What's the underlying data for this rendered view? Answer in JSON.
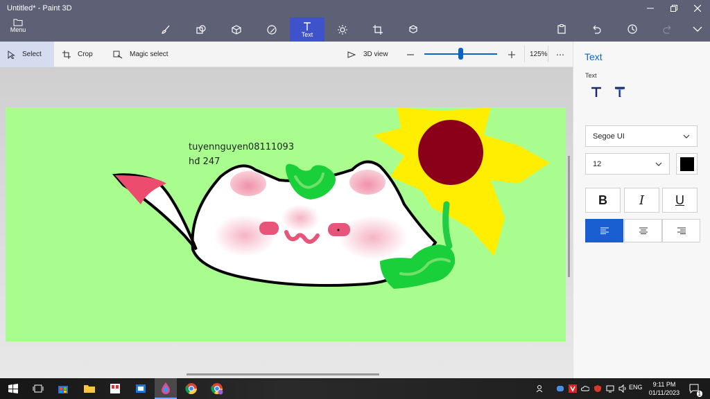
{
  "window": {
    "title": "Untitled* - Paint 3D",
    "menu_label": "Menu"
  },
  "toolbar": {
    "tools": [
      {
        "name": "brushes",
        "icon": "brush-icon"
      },
      {
        "name": "2d-shapes",
        "icon": "shapes-icon"
      },
      {
        "name": "3d-shapes",
        "icon": "cube-icon"
      },
      {
        "name": "stickers",
        "icon": "sticker-icon"
      },
      {
        "name": "text",
        "icon": "text-icon",
        "label": "Text"
      },
      {
        "name": "effects",
        "icon": "effects-icon"
      },
      {
        "name": "canvas",
        "icon": "canvas-icon"
      },
      {
        "name": "3d-library",
        "icon": "library-icon"
      }
    ],
    "active_tool_label": "Text"
  },
  "subbar": {
    "select_label": "Select",
    "crop_label": "Crop",
    "magic_select_label": "Magic select",
    "view3d_label": "3D view",
    "zoom_level": "125%",
    "zoom_fraction": 0.5
  },
  "canvas": {
    "background_color": "#a8fd8e",
    "text_line1": "tuyennguyen08111093",
    "text_line2": "hđ 247"
  },
  "panel": {
    "title": "Text",
    "section_label": "Text",
    "font_family": "Segoe UI",
    "font_size": "12",
    "text_color": "#000000",
    "bold_label": "B",
    "italic_label": "I",
    "underline_label": "U",
    "accent_color": "#1a5fd1"
  },
  "taskbar": {
    "language": "ENG",
    "time": "9:11 PM",
    "date": "01/11/2023",
    "notification_count": "1"
  }
}
